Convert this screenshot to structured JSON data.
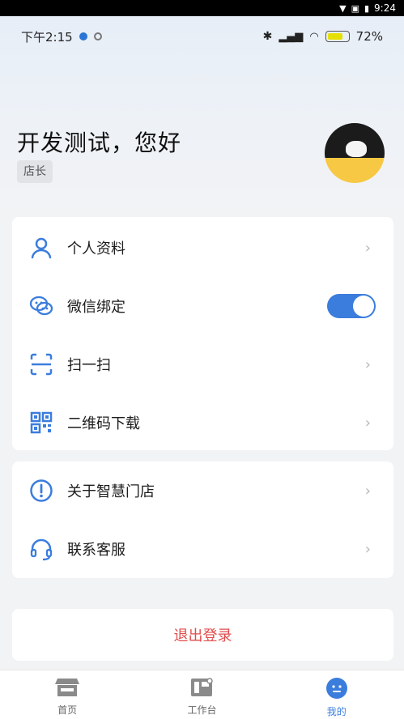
{
  "system_bar": {
    "time": "9:24"
  },
  "phone_status": {
    "time": "下午2:15",
    "battery": "72%"
  },
  "greeting": "开发测试，您好",
  "role": "店长",
  "card1": {
    "items": [
      {
        "label": "个人资料",
        "icon": "person-icon"
      },
      {
        "label": "微信绑定",
        "icon": "wechat-icon",
        "toggle": true
      },
      {
        "label": "扫一扫",
        "icon": "scan-icon"
      },
      {
        "label": "二维码下载",
        "icon": "qr-icon"
      }
    ]
  },
  "card2": {
    "items": [
      {
        "label": "关于智慧门店",
        "icon": "info-icon"
      },
      {
        "label": "联系客服",
        "icon": "headset-icon"
      }
    ]
  },
  "logout_label": "退出登录",
  "tabs": [
    {
      "label": "首页",
      "icon": "store-icon"
    },
    {
      "label": "工作台",
      "icon": "dashboard-icon"
    },
    {
      "label": "我的",
      "icon": "profile-icon",
      "active": true
    }
  ],
  "colors": {
    "accent": "#3b7ddd",
    "danger": "#e04b4b"
  }
}
